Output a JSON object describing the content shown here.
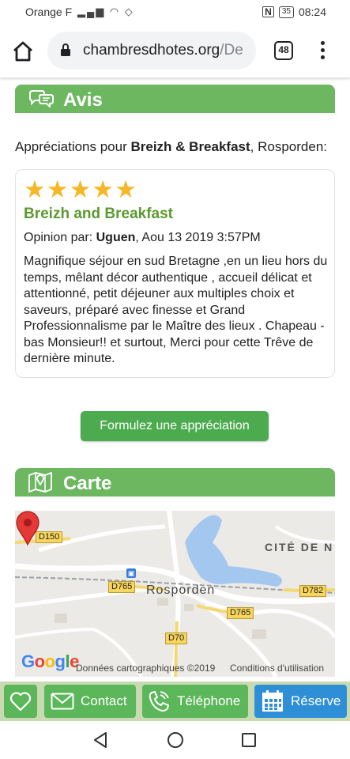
{
  "status": {
    "carrier": "Orange F",
    "battery": "35",
    "time": "08:24"
  },
  "browser": {
    "url_host": "chambresdhotes.org",
    "url_rest": "/De",
    "tab_count": "48"
  },
  "reviews_section": {
    "title": "Avis",
    "intro_prefix": "Appréciations pour ",
    "intro_name": "Breizh & Breakfast",
    "intro_suffix": ", Rosporden:",
    "review": {
      "rating": 5,
      "title": "Breizh and Breakfast",
      "by_prefix": "Opinion par: ",
      "author": "Uguen",
      "date": ", Aou 13 2019 3:57PM",
      "text": "Magnifique séjour en sud Bretagne ,en un lieu hors du temps, mêlant décor authentique , accueil délicat et attentionné, petit déjeuner aux multiples choix et saveurs, préparé avec finesse et Grand Professionnalisme par le Maître des lieux . Chapeau -bas Monsieur!! et surtout, Merci pour cette Trêve de dernière minute."
    },
    "cta_label": "Formulez une appréciation"
  },
  "map_section": {
    "title": "Carte",
    "town": "Rosporden",
    "district": "CITÉ DE N",
    "roads": [
      "D150",
      "D765",
      "D765",
      "D782",
      "D70"
    ],
    "google": "Google",
    "attribution": "Données cartographiques ©2019",
    "conditions": "Conditions d'utilisation"
  },
  "actions": {
    "contact": "Contact",
    "phone": "Téléphone",
    "reserve": "Réserve"
  },
  "colors": {
    "header_green": "#6cb760",
    "button_green": "#4cab4f",
    "title_green": "#5a9a2e",
    "reserve_blue": "#2f8fd6",
    "star": "#f5b728"
  }
}
